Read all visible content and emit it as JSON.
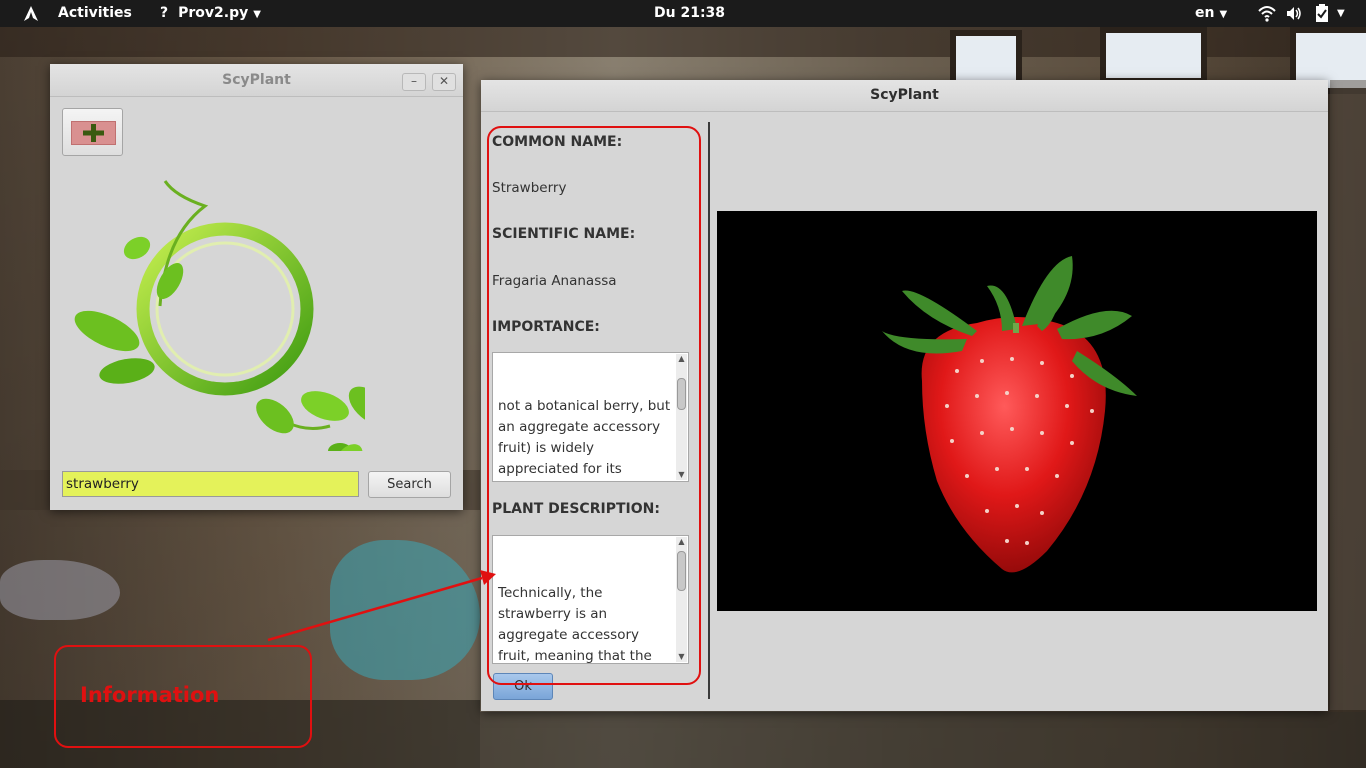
{
  "topbar": {
    "activities": "Activities",
    "app_menu": "Prov2.py",
    "clock": "Du 21:38",
    "language": "en"
  },
  "main_window": {
    "title": "ScyPlant",
    "minimize": "–",
    "close": "✕",
    "search_value": "strawberry",
    "search_button": "Search"
  },
  "info_window": {
    "title": "ScyPlant",
    "common_name_label": "COMMON NAME:",
    "common_name_value": "Strawberry",
    "scientific_name_label": "SCIENTIFIC NAME:",
    "scientific_name_value": "Fragaria Ananassa",
    "importance_label": "IMPORTANCE:",
    "importance_text": "not a botanical berry, but an aggregate accessory fruit) is widely appreciated for its characteristic aroma, bright red color, juicy texture, and sweetness. It is consumed",
    "description_label": "PLANT DESCRIPTION:",
    "description_text": "Technically, the strawberry is an aggregate accessory fruit, meaning that the fleshy part is derived not from the plant's ovaries but from the receptacle that",
    "ok_button": "Ok"
  },
  "annotation": {
    "label": "Information",
    "color": "#e01010"
  },
  "colors": {
    "search_field_bg": "#e4f25a",
    "window_bg": "#d6d6d6",
    "topbar_bg": "#1b1b1b"
  }
}
